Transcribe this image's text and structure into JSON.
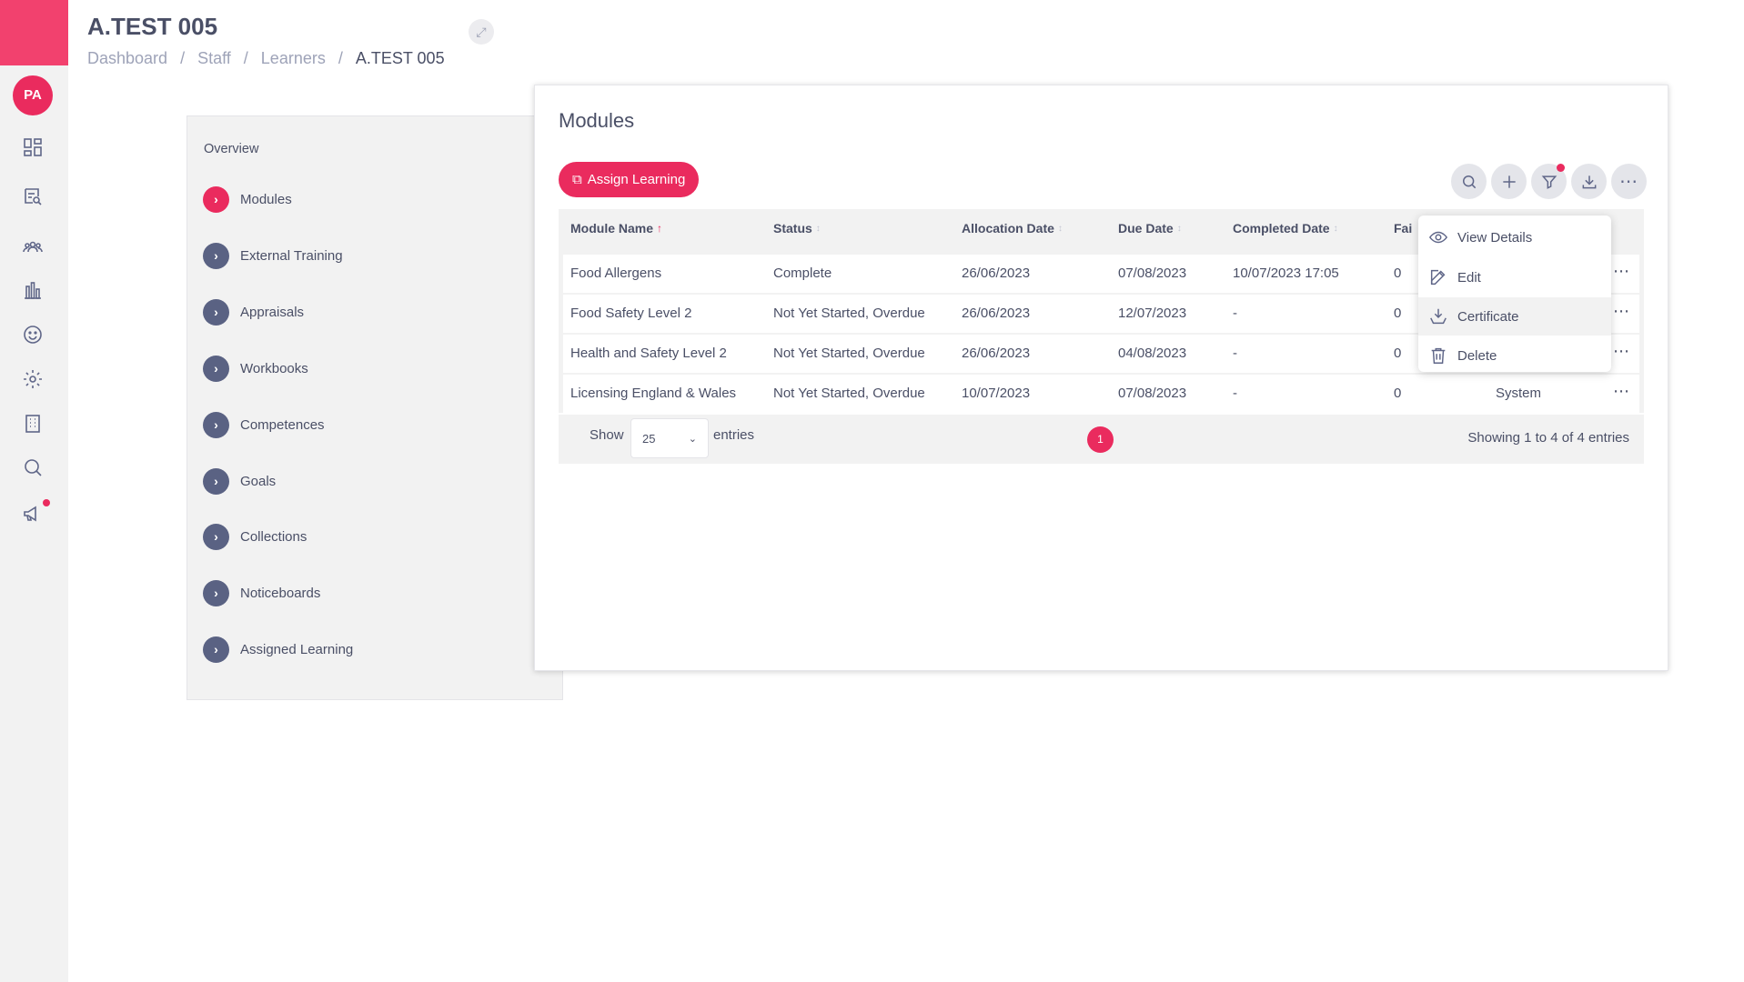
{
  "header": {
    "title": "A.TEST 005",
    "breadcrumb": [
      "Dashboard",
      "Staff",
      "Learners",
      "A.TEST 005"
    ]
  },
  "rail": {
    "avatar": "PA",
    "icons": [
      "dashboard-icon",
      "search-report-icon",
      "people-icon",
      "chart-icon",
      "smiley-icon",
      "gear-icon",
      "building-icon",
      "search-icon",
      "megaphone-icon"
    ]
  },
  "left_nav": {
    "overview": "Overview",
    "items": [
      "Modules",
      "External Training",
      "Appraisals",
      "Workbooks",
      "Competences",
      "Goals",
      "Collections",
      "Noticeboards",
      "Assigned Learning"
    ]
  },
  "modules": {
    "title": "Modules",
    "assign_button": "Assign Learning",
    "columns": [
      "Module Name",
      "Status",
      "Allocation Date",
      "Due Date",
      "Completed Date",
      "Fai"
    ],
    "rows": [
      {
        "name": "Food Allergens",
        "status": "Complete",
        "allocation": "26/06/2023",
        "due": "07/08/2023",
        "completed": "10/07/2023 17:05",
        "failed": "0",
        "source": ""
      },
      {
        "name": "Food Safety Level 2",
        "status": "Not Yet Started, Overdue",
        "allocation": "26/06/2023",
        "due": "12/07/2023",
        "completed": "-",
        "failed": "0",
        "source": ""
      },
      {
        "name": "Health and Safety Level 2",
        "status": "Not Yet Started, Overdue",
        "allocation": "26/06/2023",
        "due": "04/08/2023",
        "completed": "-",
        "failed": "0",
        "source": ""
      },
      {
        "name": "Licensing England & Wales",
        "status": "Not Yet Started, Overdue",
        "allocation": "10/07/2023",
        "due": "07/08/2023",
        "completed": "-",
        "failed": "0",
        "source": "System"
      }
    ],
    "pager": {
      "show": "Show",
      "page_size": "25",
      "entries": "entries",
      "page": "1",
      "summary": "Showing 1 to 4 of 4 entries"
    }
  },
  "row_menu": {
    "items": [
      "View Details",
      "Edit",
      "Certificate",
      "Delete"
    ]
  },
  "colors": {
    "accent": "#ea2b5e",
    "nav_circle": "#5a6283",
    "panel_bg": "#f2f2f2"
  }
}
